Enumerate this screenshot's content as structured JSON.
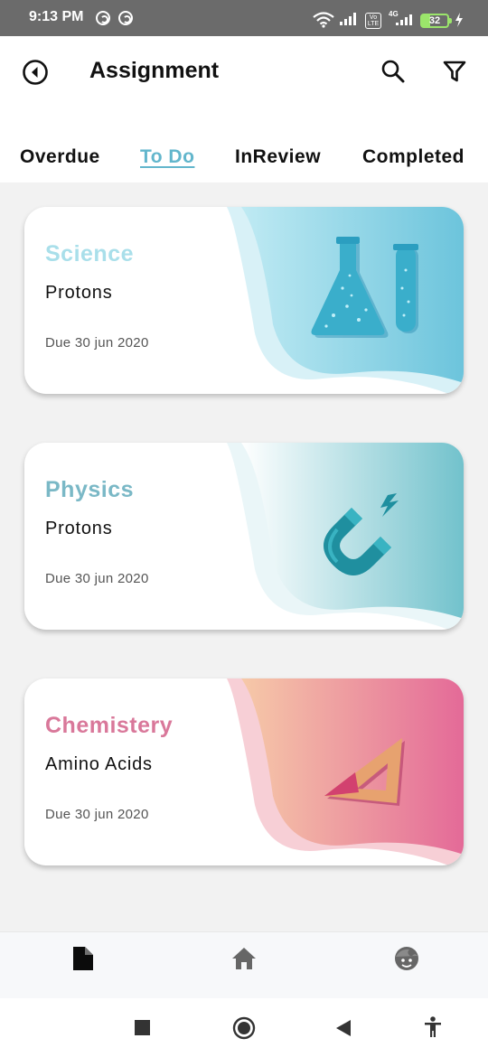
{
  "status_bar": {
    "time": "9:13 PM",
    "volte_tag": "Vo LTE",
    "network_tag": "4G",
    "battery_level": "32",
    "battery_fraction": 0.32
  },
  "header": {
    "title": "Assignment",
    "back_icon": "circle-back-arrow-icon",
    "search_icon": "search-icon",
    "filter_icon": "filter-funnel-icon"
  },
  "tabs": [
    {
      "label": "Overdue",
      "active": false
    },
    {
      "label": "To Do",
      "active": true
    },
    {
      "label": "InReview",
      "active": false
    },
    {
      "label": "Completed",
      "active": false
    }
  ],
  "assignments": [
    {
      "subject": "Science",
      "topic": "Protons",
      "due": "Due 30 jun 2020",
      "accent": "#8fd6e6",
      "illustration": "flask-and-test-tube-icon"
    },
    {
      "subject": "Physics",
      "topic": "Protons",
      "due": "Due 30 jun 2020",
      "accent": "#7ab8c6",
      "illustration": "magnet-icon"
    },
    {
      "subject": "Chemistery",
      "topic": "Amino Acids",
      "due": "Due 30 jun 2020",
      "accent": "#d9789a",
      "illustration": "set-square-icon"
    }
  ],
  "bottom_nav": [
    {
      "icon": "document-icon",
      "active": true
    },
    {
      "icon": "home-icon",
      "active": false
    },
    {
      "icon": "profile-face-icon",
      "active": false
    }
  ],
  "system_nav": [
    "recents-square-icon",
    "home-circle-icon",
    "back-triangle-icon",
    "accessibility-icon"
  ],
  "colors": {
    "tab_active": "#62b6cc",
    "background": "#f2f2f2"
  }
}
